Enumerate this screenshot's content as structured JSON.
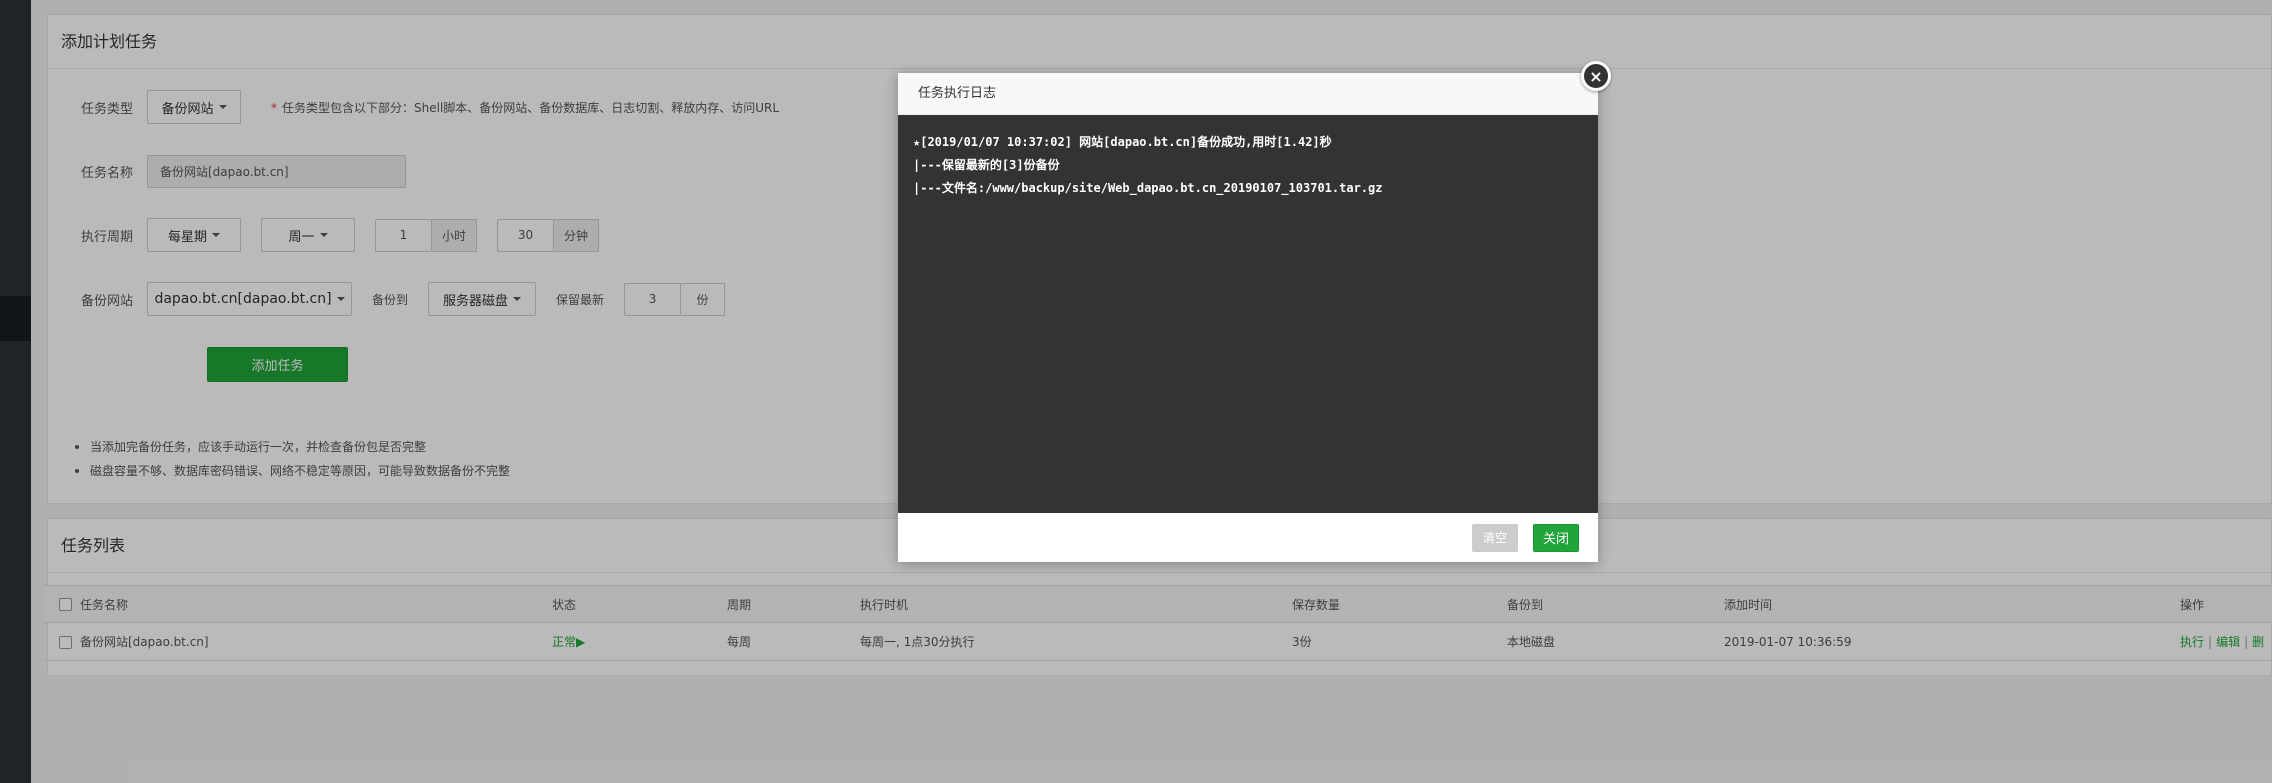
{
  "add_panel": {
    "title": "添加计划任务",
    "task_type": {
      "label": "任务类型",
      "value": "备份网站",
      "hint": "任务类型包含以下部分：Shell脚本、备份网站、备份数据库、日志切割、释放内存、访问URL",
      "hint_star": "*"
    },
    "task_name": {
      "label": "任务名称",
      "value": "备份网站[dapao.bt.cn]"
    },
    "cycle": {
      "label": "执行周期",
      "period": "每星期",
      "weekday": "周一",
      "hour": "1",
      "hour_unit": "小时",
      "minute": "30",
      "minute_unit": "分钟"
    },
    "backup": {
      "label": "备份网站",
      "site": "dapao.bt.cn[dapao.bt.cn]",
      "to_label": "备份到",
      "to": "服务器磁盘",
      "keep_label": "保留最新",
      "keep": "3",
      "keep_unit": "份"
    },
    "submit": "添加任务",
    "notes": [
      "当添加完备份任务，应该手动运行一次，并检查备份包是否完整",
      "磁盘容量不够、数据库密码错误、网络不稳定等原因，可能导致数据备份不完整"
    ]
  },
  "list_panel": {
    "title": "任务列表",
    "columns": [
      "任务名称",
      "状态",
      "周期",
      "执行时机",
      "保存数量",
      "备份到",
      "添加时间",
      "操作"
    ],
    "rows": [
      {
        "name": "备份网站[dapao.bt.cn]",
        "status": "正常▶",
        "cycle": "每周",
        "timing": "每周一, 1点30分执行",
        "count": "3份",
        "to": "本地磁盘",
        "added": "2019-01-07 10:36:59",
        "op_run": "执行",
        "op_sep": "|",
        "op_edit": "编辑",
        "op_sep2": "|",
        "op_more": "删"
      }
    ]
  },
  "modal": {
    "title": "任务执行日志",
    "close_icon": "×",
    "log": [
      "★[2019/01/07 10:37:02] 网站[dapao.bt.cn]备份成功,用时[1.42]秒",
      "|---保留最新的[3]份备份",
      "|---文件名:/www/backup/site/Web_dapao.bt.cn_20190107_103701.tar.gz"
    ],
    "clear_btn": "清空",
    "close_btn": "关闭"
  },
  "colors": {
    "accent": "#20a53a",
    "sidebar": "#2c3138",
    "log_bg": "#333333"
  }
}
